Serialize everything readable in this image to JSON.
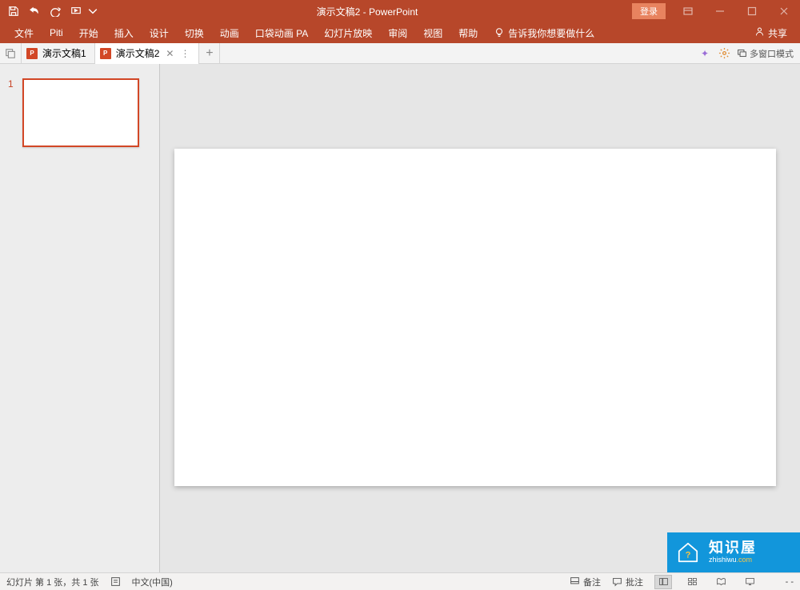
{
  "title_bar": {
    "app_title": "演示文稿2 - PowerPoint",
    "login_label": "登录"
  },
  "ribbon": {
    "tabs": [
      "文件",
      "Piti",
      "开始",
      "插入",
      "设计",
      "切换",
      "动画",
      "口袋动画 PA",
      "幻灯片放映",
      "审阅",
      "视图",
      "帮助"
    ],
    "tell_me": "告诉我你想要做什么",
    "share": "共享"
  },
  "doc_tabs": {
    "tab1": "演示文稿1",
    "tab2": "演示文稿2",
    "multiwindow": "多窗口模式"
  },
  "thumbnails": {
    "slide1_number": "1"
  },
  "brand": {
    "cn": "知识屋",
    "en_prefix": "zhishiwu",
    "en_suffix": ".com"
  },
  "status": {
    "slide_info": "幻灯片 第 1 张，共 1 张",
    "language": "中文(中国)",
    "notes": "备注",
    "comments": "批注",
    "zoom_indicator": "- -"
  }
}
